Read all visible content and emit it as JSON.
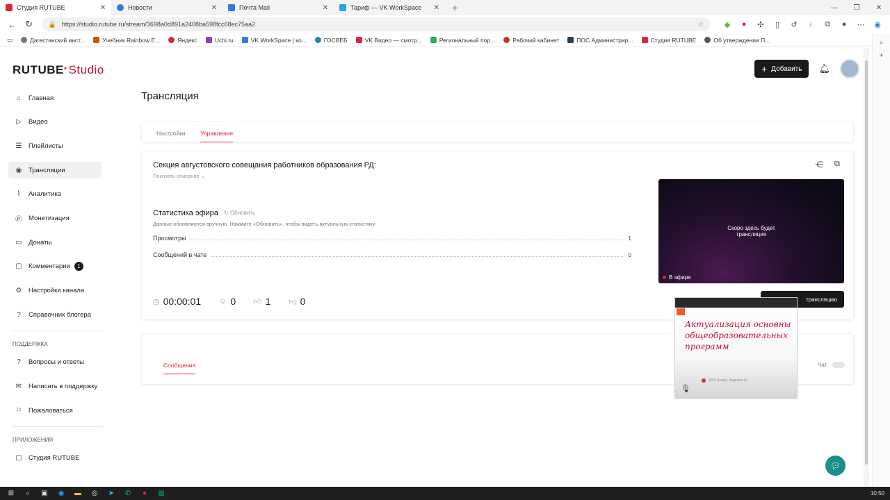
{
  "browser": {
    "tabs": [
      {
        "label": "Студия RUTUBE",
        "color": "#e0243a",
        "active": true
      },
      {
        "label": "Новости",
        "color": "#2a7de1"
      },
      {
        "label": "Почта Mail",
        "color": "#2a7de1"
      },
      {
        "label": "Тариф — VK WorkSpace",
        "color": "#2a7de1"
      }
    ],
    "url": "https://studio.rutube.ru/stream/3698a0d891a2408ba598fcc68ec75aa2",
    "bookmarks": [
      "Дагестанский инст...",
      "Учебник Rainbow E...",
      "Яндекс",
      "Uchi.ru",
      "VK WorkSpace | ко...",
      "ГОСВЕБ",
      "VK Видео — смотр...",
      "Региональный пор...",
      "Рабочий кабинет",
      "ПОС Администрир...",
      "Студия RUTUBE",
      "Об утверждении П..."
    ],
    "clock": "10:50"
  },
  "app": {
    "logo_main": "RUTUBE",
    "logo_sub": "Studio",
    "add_button": "Добавить",
    "sidebar": {
      "items": [
        {
          "label": "Главная",
          "icon": "home-icon"
        },
        {
          "label": "Видео",
          "icon": "video-icon"
        },
        {
          "label": "Плейлисты",
          "icon": "playlist-icon"
        },
        {
          "label": "Трансляции",
          "icon": "broadcast-icon",
          "active": true
        },
        {
          "label": "Аналитика",
          "icon": "analytics-icon"
        },
        {
          "label": "Монетизация",
          "icon": "monetization-icon"
        },
        {
          "label": "Донаты",
          "icon": "donate-icon"
        },
        {
          "label": "Комментарии",
          "icon": "comment-icon",
          "badge": "1"
        },
        {
          "label": "Настройки канала",
          "icon": "gear-icon"
        },
        {
          "label": "Справочник блогера",
          "icon": "help-icon"
        }
      ],
      "support_title": "ПОДДЕРЖКА",
      "support_items": [
        {
          "label": "Вопросы и ответы"
        },
        {
          "label": "Написать в поддержку"
        },
        {
          "label": "Пожаловаться"
        }
      ],
      "apps_title": "ПРИЛОЖЕНИЯ",
      "apps_items": [
        {
          "label": "Студия RUTUBE"
        }
      ]
    },
    "page_title": "Трансляция",
    "page_tabs": {
      "settings": "Настройки",
      "manage": "Управление"
    },
    "stream": {
      "title": "Секция августовского совещания работников образования РД:",
      "show_description": "Показать описание",
      "stats_title": "Статистика эфира",
      "refresh": "Обновить",
      "stats_note": "Данные обновляются вручную. Нажмите «Обновить», чтобы видеть актуальную статистику",
      "views_label": "Просмотры",
      "views_value": "1",
      "chat_label": "Сообщений в чате",
      "chat_value": "0",
      "timer": "00:00:01",
      "viewers": "0",
      "likes": "1",
      "dislikes": "0",
      "player_text_line1": "Скоро здесь будет",
      "player_text_line2": "трансляция",
      "live_label": "В эфире",
      "end_button": "трансляцию"
    },
    "messages": {
      "tab": "Сообщения",
      "chat_toggle": "Чат"
    },
    "pip": {
      "line1": "Актуализация основны",
      "line2": "общеобразовательных",
      "line3": "программ",
      "footer": "2025 &copy; dagestan.ru"
    }
  }
}
